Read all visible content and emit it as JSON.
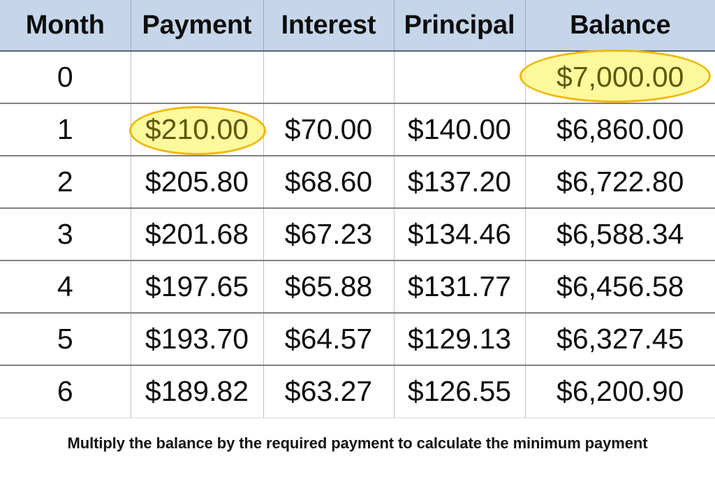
{
  "table": {
    "columns": [
      "Month",
      "Payment",
      "Interest",
      "Principal",
      "Balance"
    ],
    "rows": [
      {
        "month": "0",
        "payment": "",
        "interest": "",
        "principal": "",
        "balance": "$7,000.00"
      },
      {
        "month": "1",
        "payment": "$210.00",
        "interest": "$70.00",
        "principal": "$140.00",
        "balance": "$6,860.00"
      },
      {
        "month": "2",
        "payment": "$205.80",
        "interest": "$68.60",
        "principal": "$137.20",
        "balance": "$6,722.80"
      },
      {
        "month": "3",
        "payment": "$201.68",
        "interest": "$67.23",
        "principal": "$134.46",
        "balance": "$6,588.34"
      },
      {
        "month": "4",
        "payment": "$197.65",
        "interest": "$65.88",
        "principal": "$131.77",
        "balance": "$6,456.58"
      },
      {
        "month": "5",
        "payment": "$193.70",
        "interest": "$64.57",
        "principal": "$129.13",
        "balance": "$6,327.45"
      },
      {
        "month": "6",
        "payment": "$189.82",
        "interest": "$63.27",
        "principal": "$126.55",
        "balance": "$6,200.90"
      }
    ]
  },
  "highlights": [
    {
      "name": "balance-row-0",
      "value": "$7,000.00"
    },
    {
      "name": "payment-row-1",
      "value": "$210.00"
    }
  ],
  "caption": {
    "text": "Multiply the balance by the required payment to calculate the minimum payment"
  },
  "colors": {
    "header_background": "#c6d6ea",
    "header_text": "#0d0d0d",
    "cell_text": "#0d0d0d",
    "highlight_fill": "#fff778",
    "highlight_border": "#f2b705",
    "highlight_text": "#5c5a09",
    "row_border": "#808080",
    "column_border": "#bfbfbf",
    "page_background": "#ffffff"
  }
}
